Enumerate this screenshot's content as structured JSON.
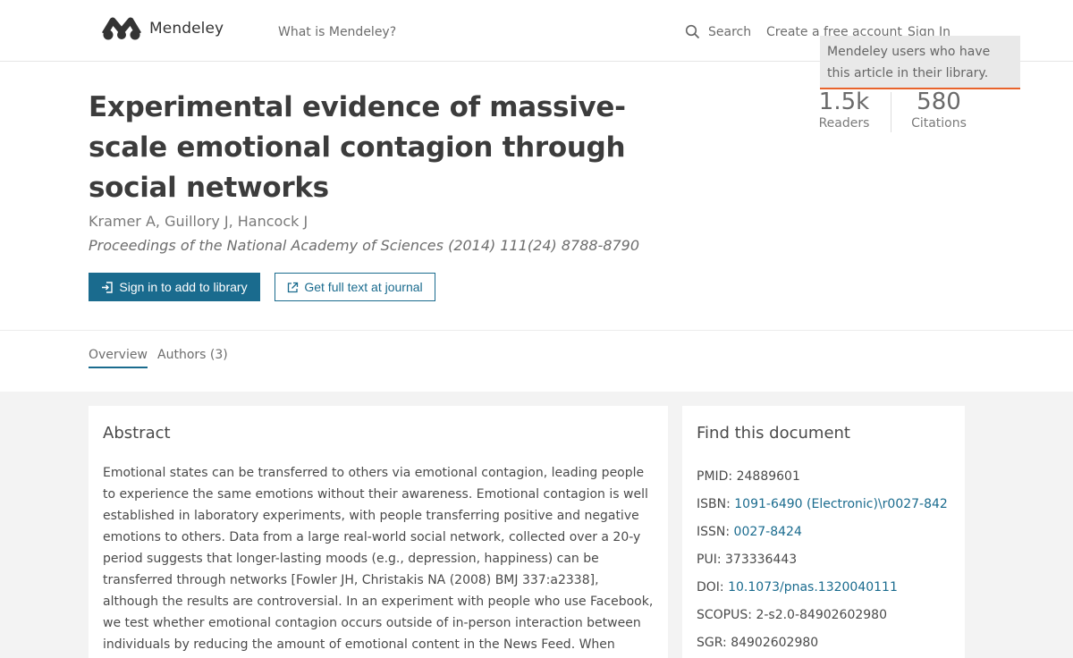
{
  "header": {
    "brand": "Mendeley",
    "nav_what": "What is Mendeley?",
    "search_label": "Search",
    "create_account": "Create a free account",
    "sign_in": "Sign In"
  },
  "tooltip": "Mendeley users who have this article in their library.",
  "article": {
    "title": "Experimental evidence of massive-scale emotional contagion through social networks",
    "authors": "Kramer A, Guillory J, Hancock J",
    "journal": "Proceedings of the National Academy of Sciences (2014) 111(24) 8788-8790",
    "btn_add": "Sign in to add to library",
    "btn_fulltext": "Get full text at journal"
  },
  "stats": {
    "readers_value": "1.5k",
    "readers_label": "Readers",
    "citations_value": "580",
    "citations_label": "Citations"
  },
  "tabs": {
    "overview": "Overview",
    "authors": "Authors (3)"
  },
  "abstract": {
    "heading": "Abstract",
    "text": "Emotional states can be transferred to others via emotional contagion, leading people to experience the same emotions without their awareness. Emotional contagion is well established in laboratory experiments, with people transferring positive and negative emotions to others. Data from a large real-world social network, collected over a 20-y period suggests that longer-lasting moods (e.g., depression, happiness) can be transferred through networks [Fowler JH, Christakis NA (2008) BMJ 337:a2338], although the results are controversial. In an experiment with people who use Facebook, we test whether emotional contagion occurs outside of in-person interaction between individuals by reducing the amount of emotional content in the News Feed. When positive expressions were reduced, people produced fewer"
  },
  "find": {
    "heading": "Find this document",
    "rows": [
      {
        "label": "PMID: ",
        "value": "24889601",
        "link": false
      },
      {
        "label": "ISBN: ",
        "value": "1091-6490 (Electronic)\\r0027-842",
        "link": true
      },
      {
        "label": "ISSN: ",
        "value": "0027-8424",
        "link": true
      },
      {
        "label": "PUI: ",
        "value": "373336443",
        "link": false
      },
      {
        "label": "DOI: ",
        "value": "10.1073/pnas.1320040111",
        "link": true
      },
      {
        "label": "SCOPUS: ",
        "value": "2-s2.0-84902602980",
        "link": false
      },
      {
        "label": "SGR: ",
        "value": "84902602980",
        "link": false
      }
    ]
  },
  "colors": {
    "accent": "#1a6b8e",
    "tooltip_border": "#e8632c",
    "background_grey": "#f3f3f3"
  }
}
